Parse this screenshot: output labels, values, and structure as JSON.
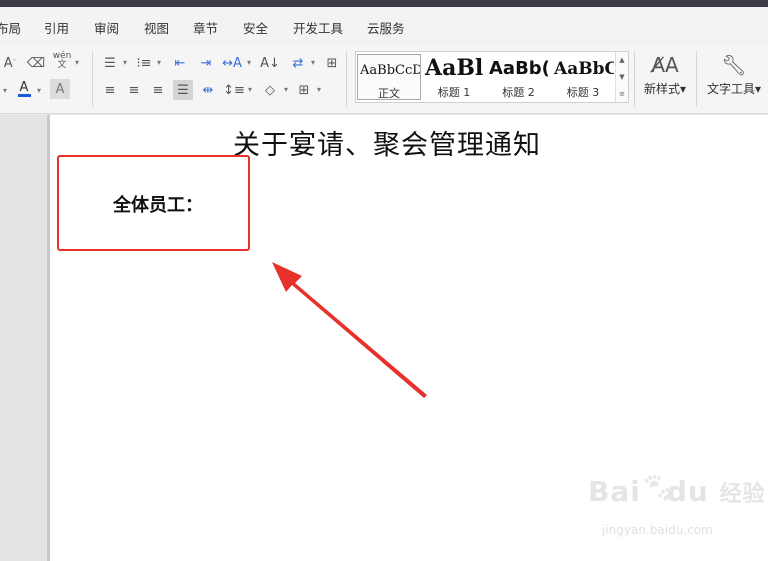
{
  "menubar": {
    "items": [
      {
        "label": "布局"
      },
      {
        "label": "引用"
      },
      {
        "label": "审阅"
      },
      {
        "label": "视图"
      },
      {
        "label": "章节"
      },
      {
        "label": "安全"
      },
      {
        "label": "开发工具"
      },
      {
        "label": "云服务"
      }
    ]
  },
  "ribbon": {
    "font_group": {
      "phonetic_label": "wén\n文",
      "font_color_letter": "A",
      "char_shading_letter": "A",
      "font_color_hex": "#1a5ad8"
    },
    "styles": [
      {
        "sample": "AaBbCcDd",
        "name": "正文"
      },
      {
        "sample": "AaBl",
        "name": "标题 1"
      },
      {
        "sample": "AaBb(",
        "name": "标题 2"
      },
      {
        "sample": "AaBbC",
        "name": "标题 3"
      }
    ],
    "new_style_label": "新样式",
    "text_tools_label": "文字工具"
  },
  "document": {
    "title": "关于宴请、聚会管理通知",
    "salutation": "全体员工："
  },
  "annotation": {
    "color": "#e8312a"
  },
  "watermark": {
    "logo_left": "Bai",
    "logo_right": "du",
    "logo_cn": "经验",
    "url": "jingyan.baidu.com"
  }
}
